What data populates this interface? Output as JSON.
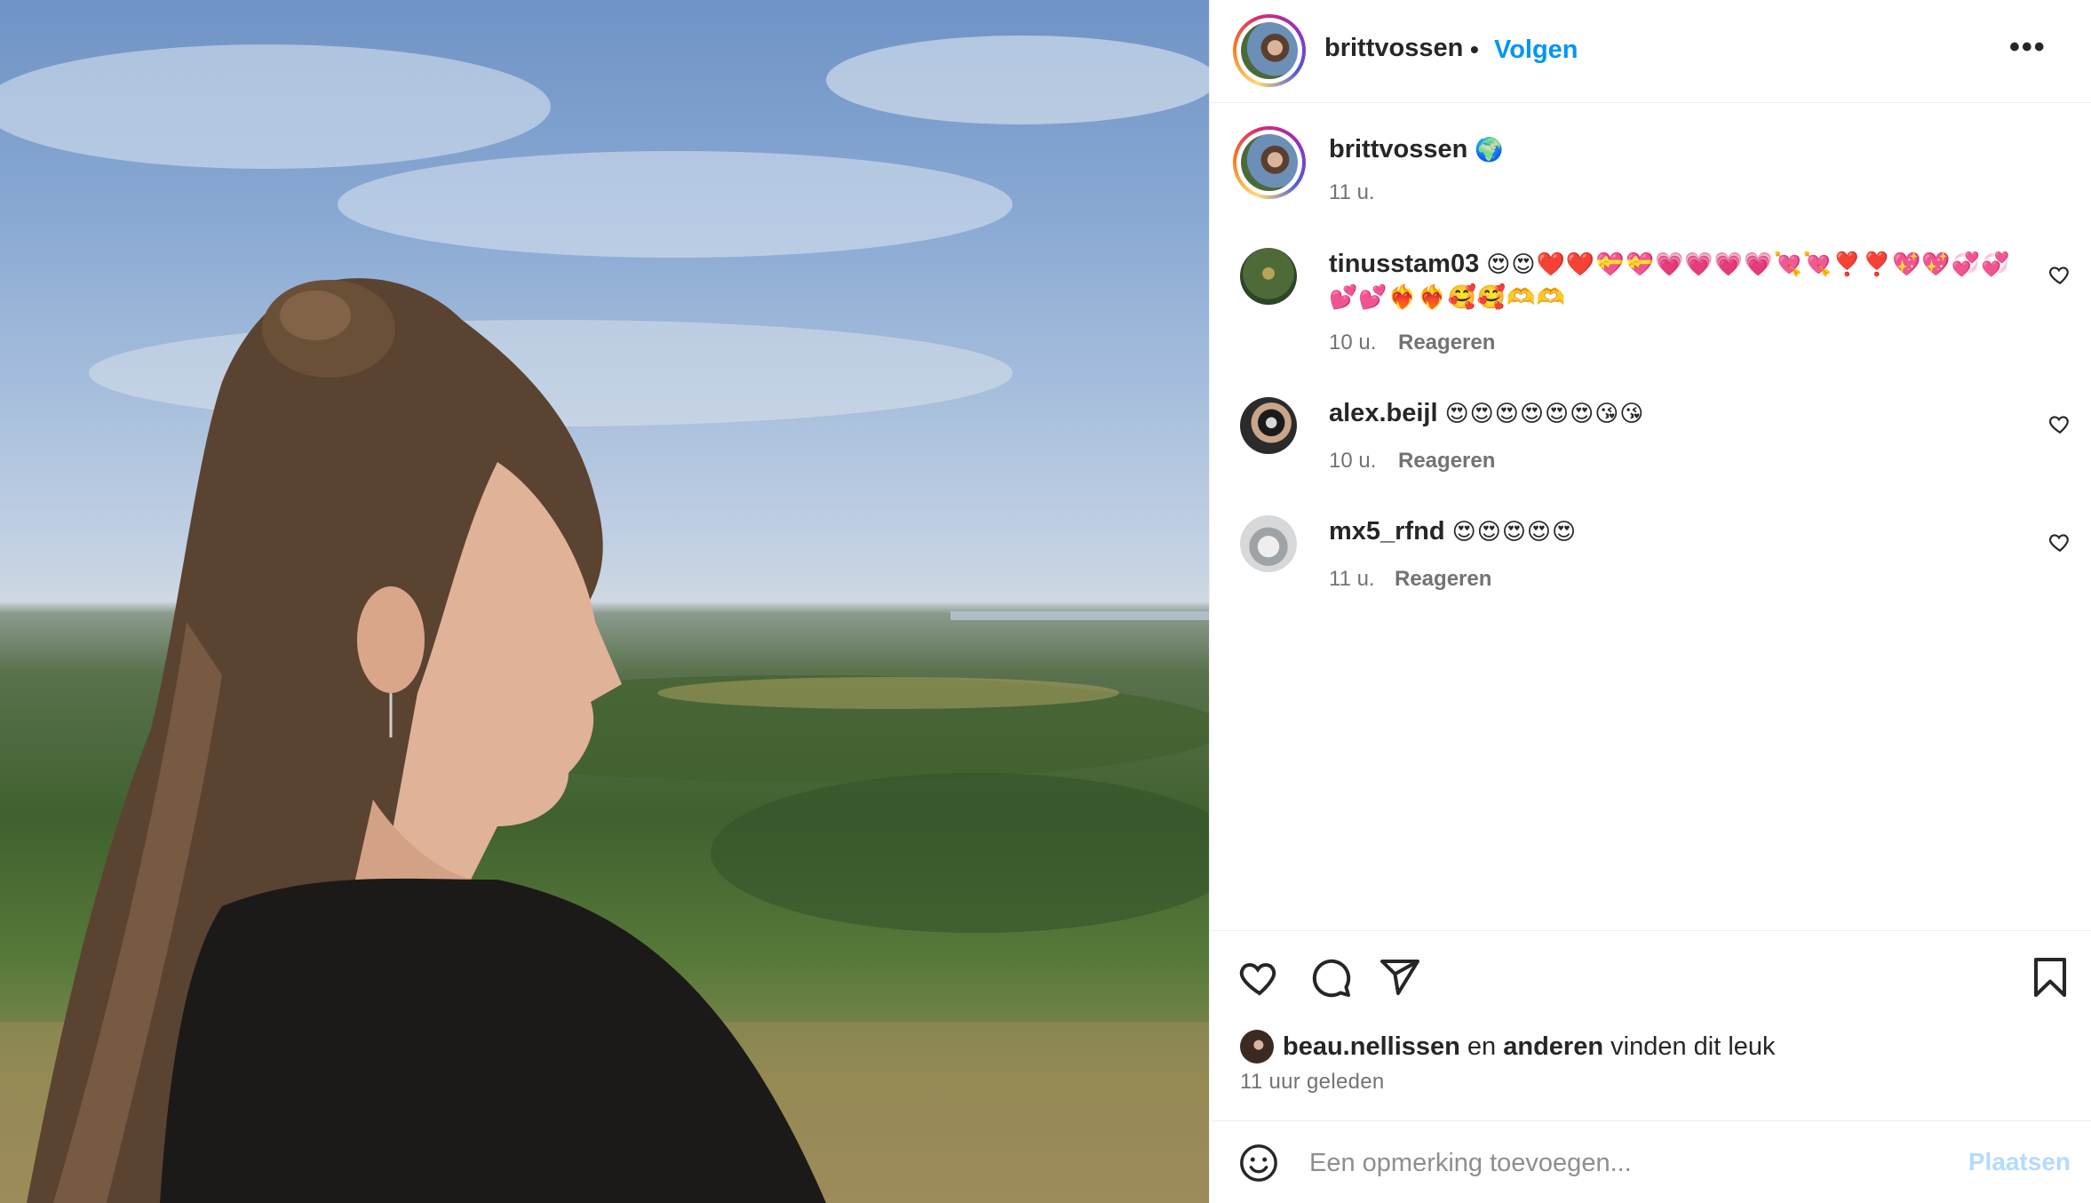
{
  "post": {
    "author": "brittvossen",
    "follow_label": "Volgen",
    "separator": "•",
    "more_label": "•••",
    "caption_emoji": "🌍",
    "caption_time": "11 u."
  },
  "comments": [
    {
      "user": "tinusstam03",
      "text": "😍😍❤️❤️💝💝💗💗💗💗💘💘❣️❣️💖💖💞💞💕💕❤️‍🔥❤️‍🔥🥰🥰🫶🫶",
      "time": "10 u.",
      "reply_label": "Reageren"
    },
    {
      "user": "alex.beijl",
      "text": "😍😍😍😍😍😍😘😘",
      "time": "10 u.",
      "reply_label": "Reageren"
    },
    {
      "user": "mx5_rfnd",
      "text": "😍😍😍😍😍",
      "time": "11 u.",
      "reply_label": "Reageren"
    }
  ],
  "likes": {
    "liker": "beau.nellissen",
    "connector": "en",
    "others": "anderen",
    "suffix": "vinden dit leuk",
    "posted_ago": "11 uur geleden"
  },
  "composer": {
    "placeholder": "Een opmerking toevoegen...",
    "post_label": "Plaatsen"
  },
  "icons": {
    "like": "heart-icon",
    "comment": "comment-icon",
    "share": "share-icon",
    "save": "bookmark-icon",
    "emoji": "smiley-icon",
    "more": "more-icon"
  },
  "colors": {
    "accent": "#0095f6",
    "post_disabled": "#b3dbff",
    "secondary_text": "#737373"
  }
}
